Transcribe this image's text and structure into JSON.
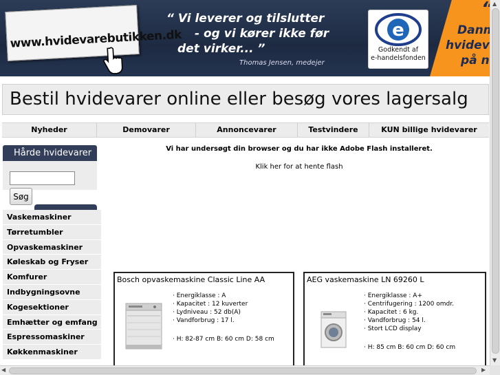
{
  "header": {
    "logo_text": "www.hvidevarebutikken.dk",
    "quote_line1": "“ Vi leverer og tilslutter",
    "quote_line2": "- og vi kører ikke før",
    "quote_line3": "det virker... ”",
    "quote_author": "Thomas Jensen, medejer",
    "badge_line1": "Godkendt af",
    "badge_line2": "e-handelsfonden",
    "promo_line1": "Danm",
    "promo_line2": "hvideva",
    "promo_line3": "på n",
    "promo_quote": "“"
  },
  "banner": {
    "text": "Bestil hvidevarer online eller besøg vores lagersalg"
  },
  "topnav": {
    "items": [
      {
        "label": "Nyheder"
      },
      {
        "label": "Demovarer"
      },
      {
        "label": "Annoncevarer"
      },
      {
        "label": "Testvindere"
      },
      {
        "label": "KUN billige hvidevarer"
      }
    ]
  },
  "sidebar": {
    "heading": "Hårde hvidevarer",
    "search_value": "",
    "search_button": "Søg",
    "items": [
      {
        "label": "Vaskemaskiner"
      },
      {
        "label": "Tørretumbler"
      },
      {
        "label": "Opvaskemaskiner"
      },
      {
        "label": "Køleskab og Fryser"
      },
      {
        "label": "Komfurer"
      },
      {
        "label": "Indbygningsovne"
      },
      {
        "label": "Kogesektioner"
      },
      {
        "label": "Emhætter og emfang"
      },
      {
        "label": "Espressomaskiner"
      },
      {
        "label": "Køkkenmaskiner"
      }
    ]
  },
  "main": {
    "flash_notice": "Vi har undersøgt din browser og du har ikke Adobe Flash installeret.",
    "flash_link": "Klik her for at hente flash"
  },
  "products": [
    {
      "title": "Bosch opvaskemaskine Classic Line AA",
      "specs": [
        "· Energiklasse : A",
        "· Kapacitet : 12 kuverter",
        "· Lydniveau : 52 db(A)",
        "· Vandforbrug : 17 l."
      ],
      "dims": "· H: 82-87 cm B: 60 cm D: 58 cm"
    },
    {
      "title": "AEG vaskemaskine LN 69260 L",
      "specs": [
        "· Energiklasse : A+",
        "· Centrifugering : 1200 omdr.",
        "· Kapacitet : 6 kg.",
        "· Vandforbrug : 54 l.",
        "· Stort LCD display"
      ],
      "dims": "· H: 85 cm B: 60 cm D: 60 cm"
    }
  ],
  "colors": {
    "header_bg": "#1d2a42",
    "side_heading_bg": "#323e59",
    "promo_orange": "#f7941d",
    "nav_bg": "#ececec"
  }
}
